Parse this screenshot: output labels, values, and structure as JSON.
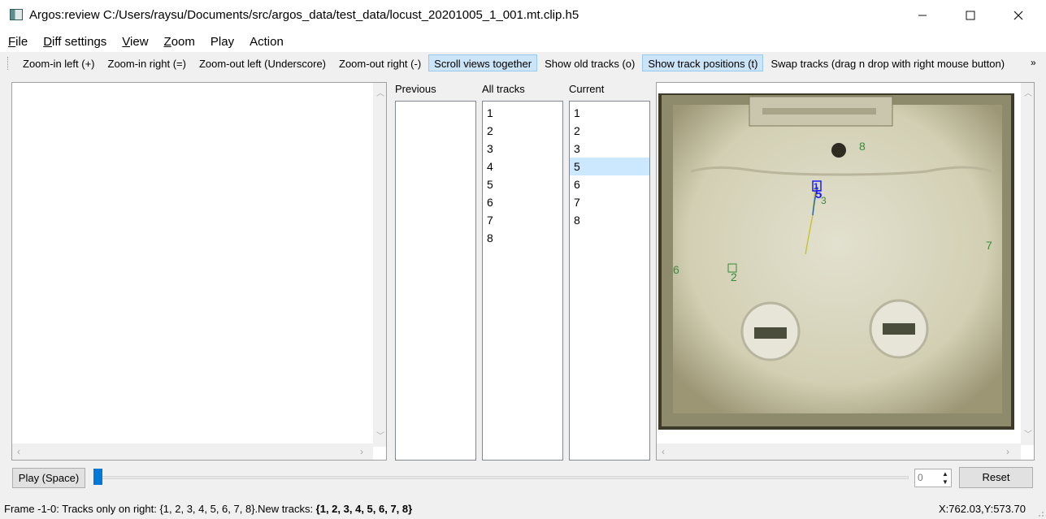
{
  "window": {
    "title": "Argos:review C:/Users/raysu/Documents/src/argos_data/test_data/locust_20201005_1_001.mt.clip.h5",
    "controls": [
      "minimize-icon",
      "maximize-icon",
      "close-icon"
    ]
  },
  "menubar": {
    "items": [
      {
        "label": "File",
        "mnemonic": "F",
        "rest": "ile"
      },
      {
        "label": "Diff settings",
        "mnemonic": "D",
        "rest": "iff settings"
      },
      {
        "label": "View",
        "mnemonic": "V",
        "rest": "iew"
      },
      {
        "label": "Zoom",
        "mnemonic": "Z",
        "rest": "oom"
      },
      {
        "label": "Play",
        "mnemonic": "",
        "rest": "Play"
      },
      {
        "label": "Action",
        "mnemonic": "",
        "rest": "Action"
      }
    ]
  },
  "toolbar": {
    "buttons": [
      {
        "label": "Zoom-in left (+)",
        "checked": false
      },
      {
        "label": "Zoom-in right (=)",
        "checked": false
      },
      {
        "label": "Zoom-out left (Underscore)",
        "checked": false
      },
      {
        "label": "Zoom-out right (-)",
        "checked": false
      },
      {
        "label": "Scroll views together",
        "checked": true
      },
      {
        "label": "Show old tracks (o)",
        "checked": false
      },
      {
        "label": "Show track positions (t)",
        "checked": true
      },
      {
        "label": "Swap tracks (drag n drop with right mouse button)",
        "checked": false
      }
    ],
    "extension": "»"
  },
  "lists": {
    "previous": {
      "label": "Previous",
      "items": []
    },
    "all_tracks": {
      "label": "All tracks",
      "items": [
        "1",
        "2",
        "3",
        "4",
        "5",
        "6",
        "7",
        "8"
      ]
    },
    "current": {
      "label": "Current",
      "items": [
        "1",
        "2",
        "3",
        "5",
        "6",
        "7",
        "8"
      ],
      "selected": "5"
    }
  },
  "arena": {
    "track_labels": [
      {
        "text": "1",
        "color": "#1a1aff"
      },
      {
        "text": "5",
        "color": "#1a1aff"
      },
      {
        "text": "2",
        "color": "#3a8a3a"
      },
      {
        "text": "3",
        "color": "#3a8a3a"
      },
      {
        "text": "6",
        "color": "#3a8a3a"
      },
      {
        "text": "7",
        "color": "#3a8a3a"
      },
      {
        "text": "8",
        "color": "#3a8a3a"
      }
    ]
  },
  "controls": {
    "play_label": "Play (Space)",
    "frame_value": "0",
    "reset_label": "Reset",
    "slider_fraction": 0.0
  },
  "status": {
    "message_prefix": "Frame -1-0: Tracks only on right: {1, 2, 3, 4, 5, 6, 7, 8}.New tracks: ",
    "message_bold": "{1, 2, 3, 4, 5, 6, 7, 8}",
    "coords": "X:762.03,Y:573.70"
  },
  "colors": {
    "accent": "#0078d7",
    "checked_bg": "#cce4f7",
    "selected_row": "#cce8ff"
  }
}
